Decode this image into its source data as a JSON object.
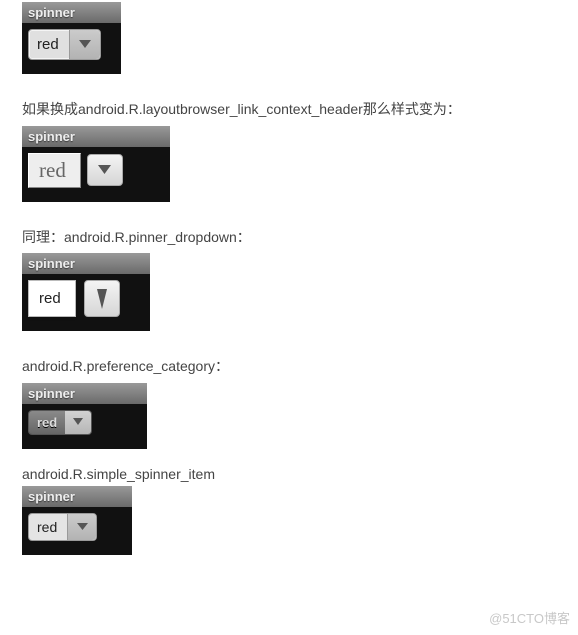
{
  "examples": [
    {
      "desc": "",
      "title": "spinner",
      "value": "red",
      "style": "A"
    },
    {
      "desc": "如果换成android.R.layoutbrowser_link_context_header那么样式变为：",
      "title": "spinner",
      "value": "red",
      "style": "B"
    },
    {
      "desc": "同理：android.R.pinner_dropdown：",
      "title": "spinner",
      "value": "red",
      "style": "C"
    },
    {
      "desc": "android.R.preference_category：",
      "title": "spinner",
      "value": "red",
      "style": "D"
    },
    {
      "desc": "android.R.simple_spinner_item",
      "title": "spinner",
      "value": "red",
      "style": "E"
    }
  ],
  "watermark": "@51CTO博客"
}
